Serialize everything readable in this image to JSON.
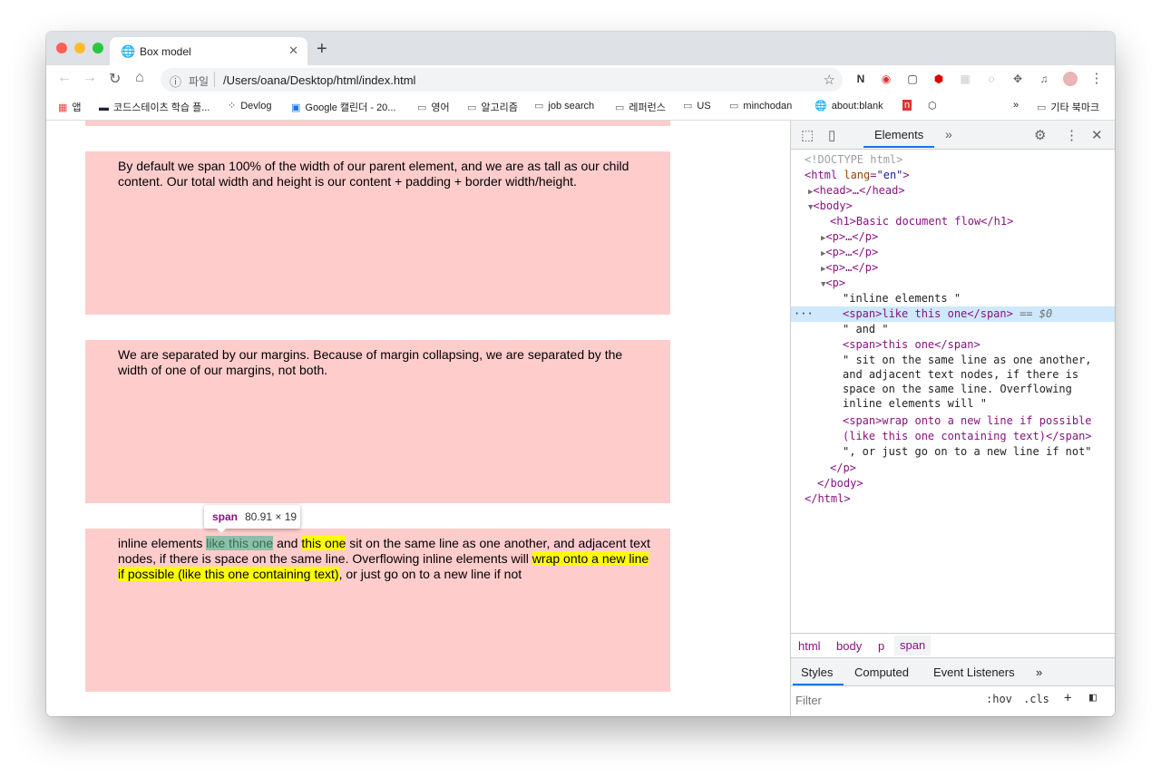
{
  "browser": {
    "tab_title": "Box model",
    "tab_close": "✕",
    "new_tab": "+",
    "scheme_label": "파일",
    "url": "/Users/oana/Desktop/html/index.html"
  },
  "bookmarks": [
    {
      "label": "앱"
    },
    {
      "label": "코드스테이츠 학습 플..."
    },
    {
      "label": "Devlog"
    },
    {
      "label": "Google 캘린더 - 20..."
    },
    {
      "label": "영어"
    },
    {
      "label": "알고리즘"
    },
    {
      "label": "job search"
    },
    {
      "label": "레퍼런스"
    },
    {
      "label": "US"
    },
    {
      "label": "minchodan"
    },
    {
      "label": "about:blank"
    },
    {
      "label": "»"
    },
    {
      "label": "기타 북마크"
    }
  ],
  "page": {
    "box2_text": "By default we span 100% of the width of our parent element, and we are as tall as our child content. Our total width and height is our content + padding + border width/height.",
    "box3_text": "We are separated by our margins. Because of margin collapsing, we are separated by the width of one of our margins, not both.",
    "box4": {
      "t1": "inline elements ",
      "span1": "like this one",
      "t2": " and ",
      "span2": "this one",
      "t3": " sit on the same line as one another, and adjacent text nodes, if there is space on the same line. Overflowing inline elements will ",
      "span3": "wrap onto a new line if possible (like this one containing text)",
      "t4": ", or just go on to a new line if not"
    },
    "tooltip": {
      "tag": "span",
      "size": "80.91 × 19"
    }
  },
  "devtools": {
    "panel_tab": "Elements",
    "more": "»",
    "dom": {
      "doctype": "<!DOCTYPE html>",
      "html_open": "<html",
      "lang_attr": "lang",
      "lang_val": "\"en\"",
      "head": "<head>…</head>",
      "body_open": "<body>",
      "h1": "<h1>Basic document flow</h1>",
      "p_collapsed": "<p>…</p>",
      "p_open": "<p>",
      "text1": "\"inline elements \"",
      "span_sel": "<span>like this one</span>",
      "eq0": "== $0",
      "text2": "\" and \"",
      "span2": "<span>this one</span>",
      "text3a": "\" sit on the same line as one another,",
      "text3b": "and adjacent text nodes, if there is",
      "text3c": "space on the same line. Overflowing",
      "text3d": "inline elements will \"",
      "span3a": "<span>wrap onto a new line if possible",
      "span3b": "(like this one containing text)</span>",
      "text4": "\", or just go on to a new line if not\"",
      "p_close": "</p>",
      "body_close": "</body>",
      "html_close": "</html>",
      "ellipsis": "···"
    },
    "breadcrumbs": [
      "html",
      "body",
      "p",
      "span"
    ],
    "subtabs": [
      "Styles",
      "Computed",
      "Event Listeners",
      "»"
    ],
    "filter_placeholder": "Filter",
    "hov": ":hov",
    "cls": ".cls"
  }
}
